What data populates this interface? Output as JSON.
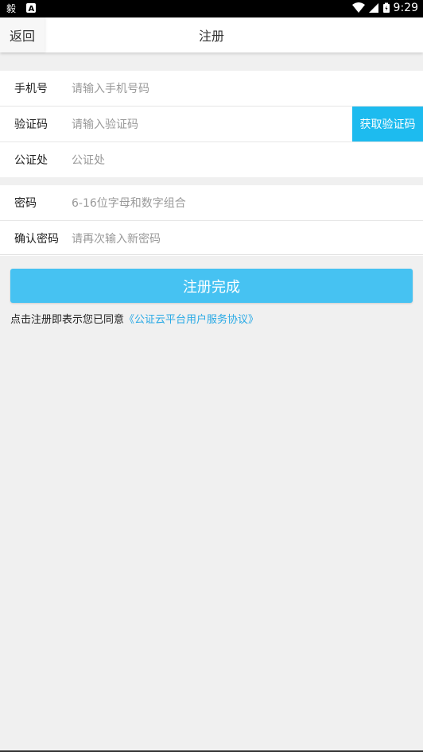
{
  "status_bar": {
    "time": "9:29",
    "left_icons": [
      "notification-app-icon",
      "font-icon"
    ],
    "right_icons": [
      "wifi-icon",
      "signal-icon",
      "battery-icon"
    ]
  },
  "header": {
    "back_label": "返回",
    "title": "注册"
  },
  "form": {
    "phone": {
      "label": "手机号",
      "placeholder": "请输入手机号码"
    },
    "code": {
      "label": "验证码",
      "placeholder": "请输入验证码",
      "button": "获取验证码"
    },
    "notary": {
      "label": "公证处",
      "placeholder": "公证处"
    },
    "password": {
      "label": "密码",
      "placeholder": "6-16位字母和数字组合"
    },
    "confirm": {
      "label": "确认密码",
      "placeholder": "请再次输入新密码"
    }
  },
  "submit_label": "注册完成",
  "agreement": {
    "text": "点击注册即表示您已同意",
    "link": "《公证云平台用户服务协议》"
  },
  "colors": {
    "accent": "#1dbbef",
    "submit": "#46c2f2",
    "link": "#28a9e5",
    "background": "#f0f0f0"
  }
}
